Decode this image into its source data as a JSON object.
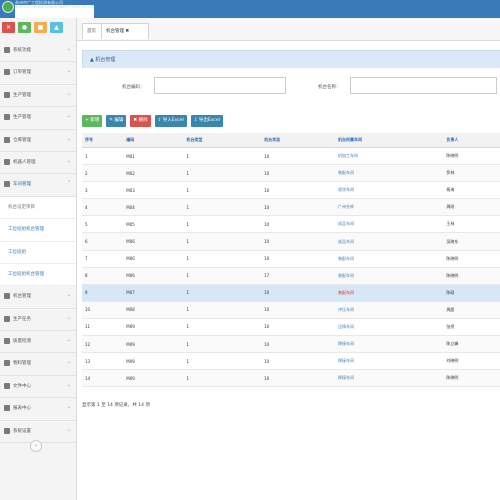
{
  "header": {
    "company_line1": "苏州中广工程检测有限公司",
    "company_line2": "SUZHOU ZHONGGUANG INSPECTION CO.,LTD"
  },
  "quick_buttons": [
    {
      "icon": "close-icon",
      "color": "#d9534f",
      "glyph": "✕"
    },
    {
      "icon": "user-icon",
      "color": "#5cb85c",
      "glyph": "●"
    },
    {
      "icon": "bell-icon",
      "color": "#f0ad4e",
      "glyph": "■"
    },
    {
      "icon": "gear-icon",
      "color": "#5bc0de",
      "glyph": "▲"
    }
  ],
  "sidebar": {
    "items_top": [
      {
        "label": "系统功能"
      },
      {
        "label": "订单管理"
      },
      {
        "label": "生产管理"
      },
      {
        "label": "生产管理"
      },
      {
        "label": "仓库管理"
      },
      {
        "label": "机器人管理"
      },
      {
        "label": "车间管理"
      }
    ],
    "sub_items": [
      {
        "label": "机台设定项目"
      },
      {
        "label": "工位班组机台管理"
      },
      {
        "label": "工位班组"
      },
      {
        "label": "工位班组机台管理"
      }
    ],
    "items_bottom": [
      {
        "label": "机台管理"
      },
      {
        "label": "生产任务"
      },
      {
        "label": "质量检测"
      },
      {
        "label": "物料管理"
      },
      {
        "label": "文件中心"
      },
      {
        "label": "报表中心"
      },
      {
        "label": "系统设置"
      }
    ],
    "collapse_glyph": "«"
  },
  "tabs": {
    "home": "首页",
    "current": "机台管理 ✖"
  },
  "panel": {
    "title": "▲ 机台管理",
    "field1_label": "机台编码：",
    "field2_label": "机台名称："
  },
  "toolbar": [
    {
      "label": "+ 新增",
      "color": "#5cb85c"
    },
    {
      "label": "✎ 编辑",
      "color": "#3a87ad"
    },
    {
      "label": "✖ 删除",
      "color": "#d9534f"
    },
    {
      "label": "⇪ 导入Excel",
      "color": "#3a87ad"
    },
    {
      "label": "⇩ 导出Excel",
      "color": "#3a87ad"
    }
  ],
  "table": {
    "columns": [
      "序号",
      "编码",
      "机台类型",
      "机台状态",
      "机台所属车间",
      "负责人"
    ],
    "rows": [
      [
        "1",
        "M01",
        "1",
        "10",
        "机加工车间",
        "陈晓明"
      ],
      [
        "2",
        "M02",
        "1",
        "10",
        "装配车间",
        "罗林"
      ],
      [
        "3",
        "M03",
        "1",
        "10",
        "喷涂车间",
        "杨海"
      ],
      [
        "4",
        "M04",
        "1",
        "10",
        "广州仓库",
        "周刚"
      ],
      [
        "5",
        "M05",
        "1",
        "10",
        "成品车间",
        "王林"
      ],
      [
        "6",
        "M06",
        "1",
        "10",
        "成品车间",
        "吴晓东"
      ],
      [
        "7",
        "M06",
        "1",
        "10",
        "装配车间",
        "陈晓明"
      ],
      [
        "8",
        "M06",
        "1",
        "17",
        "装配车间",
        "陈晓明"
      ],
      [
        "9",
        "M07",
        "1",
        "10",
        "装配车间",
        "陈硕"
      ],
      [
        "10",
        "M08",
        "1",
        "10",
        "冲压车间",
        "周超"
      ],
      [
        "11",
        "M09",
        "1",
        "10",
        "压铸车间",
        "张然"
      ],
      [
        "12",
        "M09",
        "1",
        "10",
        "焊接车间",
        "陈立峰"
      ],
      [
        "13",
        "M09",
        "1",
        "10",
        "焊接车间",
        "刘晓明"
      ],
      [
        "14",
        "M09",
        "1",
        "10",
        "焊接车间",
        "陈晓明"
      ]
    ],
    "selected_row": 8
  },
  "pager": {
    "text": "显示第 1 至 14 项记录，共 14 项"
  }
}
